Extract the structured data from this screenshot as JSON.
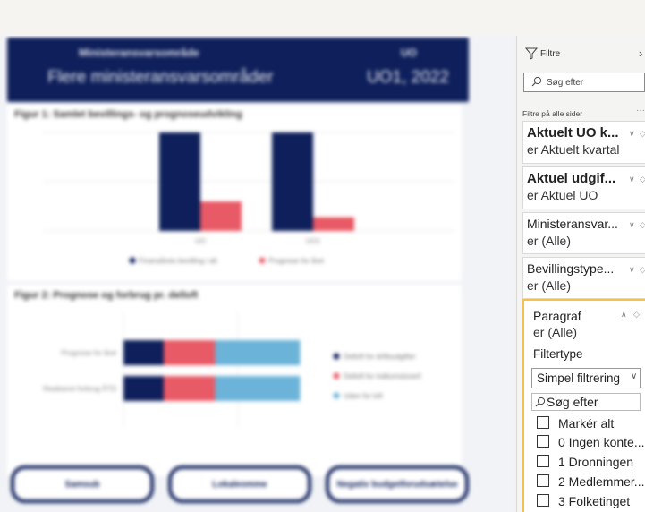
{
  "report": {
    "header_sub": "Ministeransvarsområde",
    "header_title": "Flere ministeransvarsområder",
    "header_rsub": "UO",
    "header_rtitle": "UO1, 2022",
    "figure1_title": "Figur 1: Samlet bevillings- og prognoseudvikling",
    "figure2_title": "Figur 2: Prognose og forbrug pr. delloft",
    "buttons": [
      "Samsub",
      "Lokaleomme",
      "Negativ budgetforudsætelse"
    ],
    "colors": {
      "navy": "#0e1f5b",
      "red": "#e85a66",
      "blue": "#6bb3d8",
      "accent": "#f2c14e"
    }
  },
  "chart_data": [
    {
      "type": "bar",
      "title": "Figur 1: Samlet bevillings- og prognoseudvikling",
      "categories": [
        "UO",
        "UO1"
      ],
      "series": [
        {
          "name": "Finansårets bevilling i alt",
          "values": [
            1.0,
            1.0
          ]
        },
        {
          "name": "Prognose for året",
          "values": [
            0.3,
            0.14
          ]
        }
      ],
      "ylim": [
        0,
        1.0
      ],
      "grid": true,
      "legend": "bottom"
    },
    {
      "type": "bar",
      "title": "Figur 2: Prognose og forbrug pr. delloft",
      "categories": [
        "Prognose for året",
        "Realiseret forbrug ÅTD"
      ],
      "series": [
        {
          "name": "Delloft for driftsudgifter",
          "values": [
            0.9,
            0.9
          ]
        },
        {
          "name": "Delloft for indkomstoverf.",
          "values": [
            1.15,
            1.15
          ]
        },
        {
          "name": "Uden for loft",
          "values": [
            1.9,
            1.9
          ]
        }
      ],
      "orientation": "horizontal",
      "stacked": true,
      "legend": "right"
    }
  ],
  "filter_pane": {
    "title": "Filtre",
    "search_placeholder": "Søg efter",
    "section_label": "Filtre på alle sider",
    "more": "···",
    "filters": [
      {
        "name": "Aktuelt UO k...",
        "value": "er Aktuelt kvartal",
        "bold": true
      },
      {
        "name": "Aktuel udgif...",
        "value": "er Aktuel UO",
        "bold": true
      },
      {
        "name": "Ministeransvar...",
        "value": "er (Alle)",
        "bold": false
      },
      {
        "name": "Bevillingstype...",
        "value": "er (Alle)",
        "bold": false
      }
    ],
    "active_filter": {
      "name": "Paragraf",
      "value": "er (Alle)",
      "type_label": "Filtertype",
      "type_value": "Simpel filtrering",
      "search_placeholder": "Søg efter",
      "options": [
        "Markér alt",
        "0 Ingen konte...",
        "1 Dronningen",
        "2 Medlemmer...",
        "3 Folketinget"
      ]
    }
  }
}
